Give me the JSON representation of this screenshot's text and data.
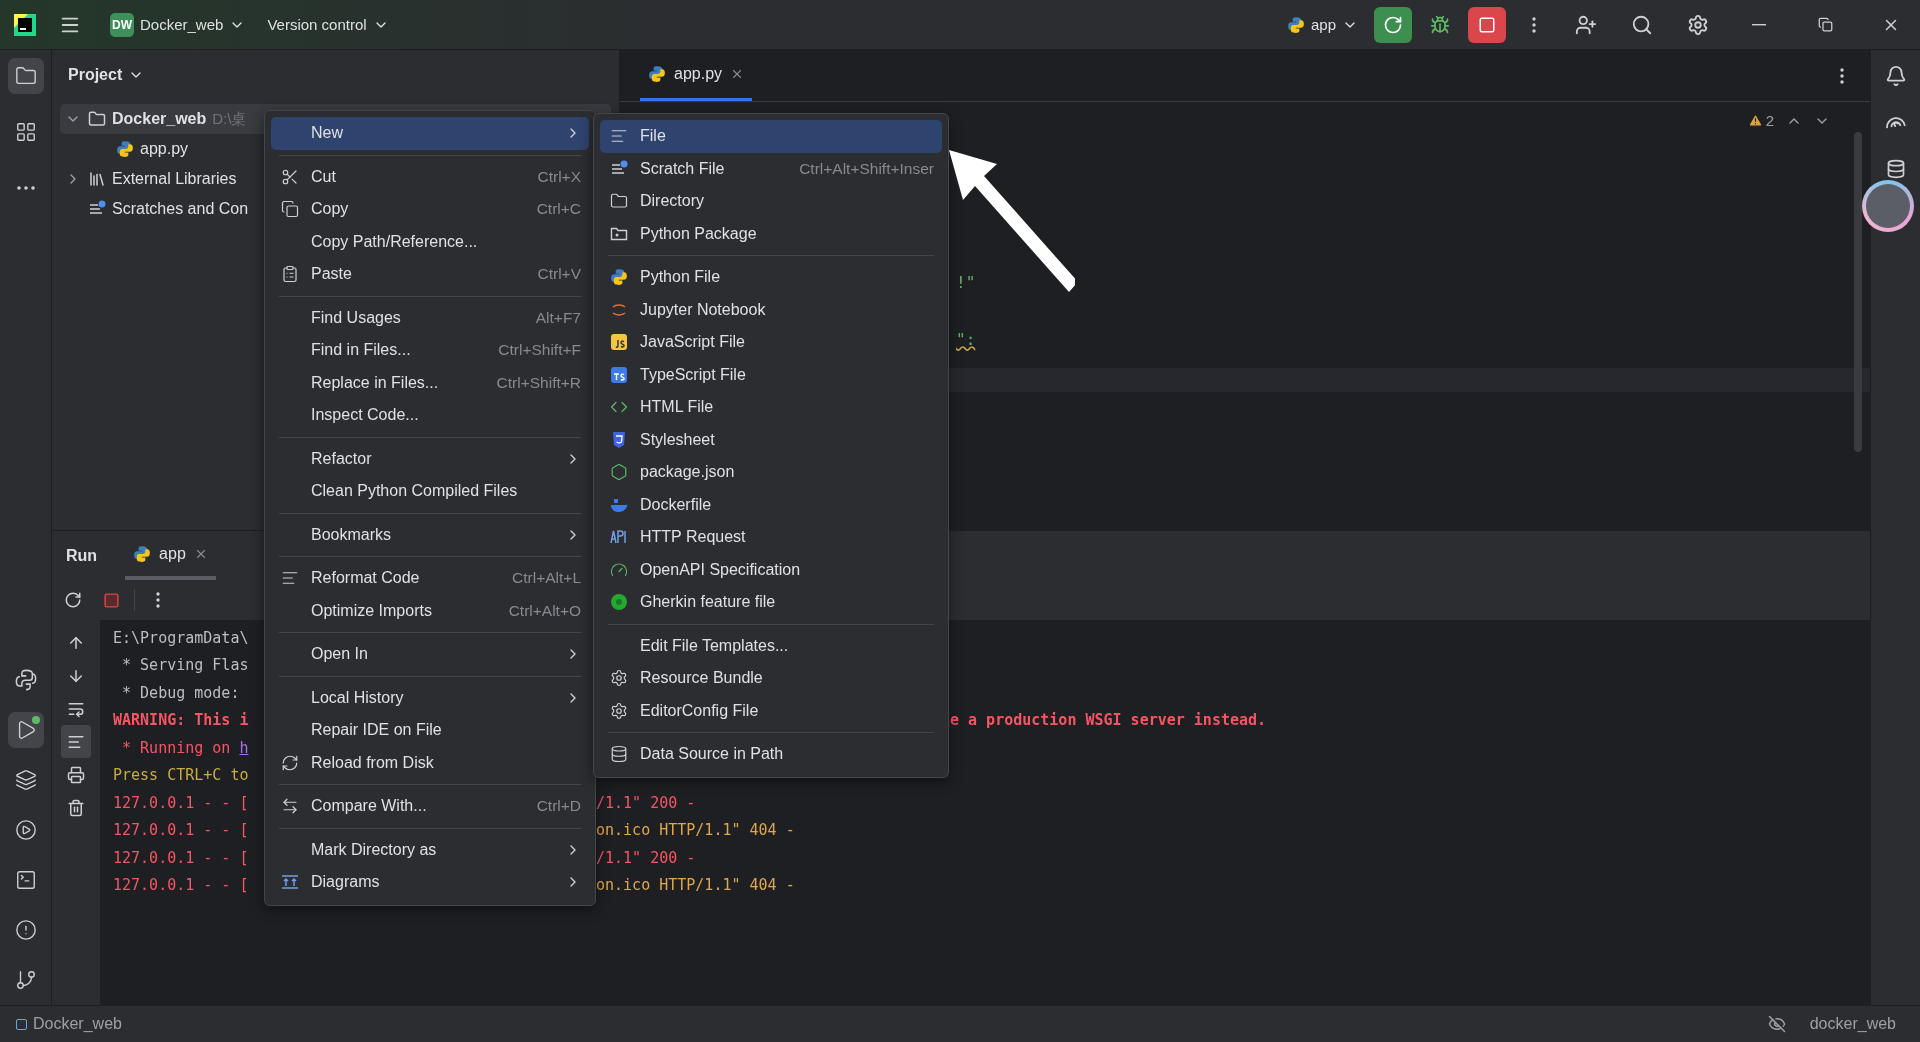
{
  "title_bar": {
    "project_badge": "DW",
    "project": "Docker_web",
    "vcs": "Version control",
    "run_config": "app"
  },
  "left_toolbar": {
    "top": [
      {
        "kind": "folder",
        "selected": true,
        "running": false
      },
      {
        "kind": "structure",
        "selected": false,
        "running": false
      },
      {
        "kind": "more",
        "selected": false,
        "running": false
      }
    ],
    "bottom": [
      {
        "kind": "python",
        "selected": false,
        "running": false
      },
      {
        "kind": "run",
        "selected": true,
        "running": true
      },
      {
        "kind": "layers",
        "selected": false,
        "running": false
      },
      {
        "kind": "services",
        "selected": false,
        "running": false
      },
      {
        "kind": "terminal",
        "selected": false,
        "running": false
      },
      {
        "kind": "problems",
        "selected": false,
        "running": false
      },
      {
        "kind": "git",
        "selected": false,
        "running": false
      }
    ]
  },
  "project_panel": {
    "title": "Project",
    "tree": [
      {
        "label": "Docker_web",
        "hint": "D:\\桌",
        "kind": "folder",
        "expanded": true,
        "selected": true,
        "children": [
          {
            "label": "app.py",
            "kind": "python",
            "selected": false
          }
        ]
      },
      {
        "label": "External Libraries",
        "kind": "library",
        "expanded": false,
        "selected": false
      },
      {
        "label": "Scratches and Con",
        "kind": "scratch",
        "selected": false
      }
    ]
  },
  "editor": {
    "tabs": [
      {
        "label": "app.py",
        "selected": true
      }
    ],
    "warnings": "2",
    "code_fragments": [
      {
        "text": "!\"",
        "kind": "plain",
        "color": "#6aab73"
      },
      {
        "text": "\":",
        "kind": "underlined",
        "color": "#6aab73"
      }
    ]
  },
  "run_panel": {
    "title": "Run",
    "tabs": [
      {
        "label": "app",
        "selected": true
      }
    ],
    "console": [
      {
        "kind": "plain",
        "parts": [
          {
            "text": "E:\\ProgramData\\",
            "kind": "text",
            "color": "#bcbec4"
          }
        ]
      },
      {
        "kind": "plain",
        "parts": [
          {
            "text": " * Serving Flas",
            "kind": "text",
            "color": "#bcbec4"
          }
        ]
      },
      {
        "kind": "plain",
        "parts": [
          {
            "text": " * Debug mode: ",
            "kind": "text",
            "color": "#bcbec4"
          }
        ]
      },
      {
        "kind": "far",
        "parts": [
          {
            "text": "WARNING: This i",
            "kind": "bold",
            "color": "#f75464"
          }
        ],
        "rest": [
          {
            "text": "e a production WSGI server instead.",
            "kind": "bold",
            "color": "#f75464"
          }
        ]
      },
      {
        "kind": "plain",
        "parts": [
          {
            "text": " * Running on ",
            "kind": "text",
            "color": "#f75464"
          },
          {
            "text": "h",
            "kind": "link",
            "color": "#a571e6"
          }
        ]
      },
      {
        "kind": "plain",
        "parts": [
          {
            "text": "Press CTRL+C to",
            "kind": "text",
            "color": "#c9ad3e"
          }
        ]
      },
      {
        "kind": "near",
        "parts": [
          {
            "text": "127.0.0.1 - - [",
            "kind": "text",
            "color": "#f75464"
          }
        ],
        "rest": [
          {
            "text": "/1.1\" 200 -",
            "kind": "text",
            "color": "#f75464"
          }
        ]
      },
      {
        "kind": "near",
        "parts": [
          {
            "text": "127.0.0.1 - - [",
            "kind": "text",
            "color": "#f75464"
          }
        ],
        "rest": [
          {
            "text": "on.ico HTTP/1.1\" 404 -",
            "kind": "text",
            "color": "#e0a84a"
          }
        ]
      },
      {
        "kind": "near",
        "parts": [
          {
            "text": "127.0.0.1 - - [",
            "kind": "text",
            "color": "#f75464"
          }
        ],
        "rest": [
          {
            "text": "/1.1\" 200 -",
            "kind": "text",
            "color": "#f75464"
          }
        ]
      },
      {
        "kind": "near",
        "parts": [
          {
            "text": "127.0.0.1 - - [",
            "kind": "text",
            "color": "#f75464"
          }
        ],
        "rest": [
          {
            "text": "on.ico HTTP/1.1\" 404 -",
            "kind": "text",
            "color": "#e0a84a"
          }
        ]
      }
    ]
  },
  "context_menu": {
    "groups": [
      [
        {
          "label": "New",
          "kind": "plain",
          "submenu": true,
          "selected": true
        }
      ],
      [
        {
          "label": "Cut",
          "shortcut": "Ctrl+X",
          "kind": "cut",
          "submenu": false,
          "selected": false
        },
        {
          "label": "Copy",
          "shortcut": "Ctrl+C",
          "kind": "copy",
          "submenu": false,
          "selected": false
        },
        {
          "label": "Copy Path/Reference...",
          "kind": "plain",
          "submenu": false,
          "selected": false
        },
        {
          "label": "Paste",
          "shortcut": "Ctrl+V",
          "kind": "paste",
          "submenu": false,
          "selected": false
        }
      ],
      [
        {
          "label": "Find Usages",
          "shortcut": "Alt+F7",
          "kind": "plain",
          "submenu": false,
          "selected": false
        },
        {
          "label": "Find in Files...",
          "shortcut": "Ctrl+Shift+F",
          "kind": "plain",
          "submenu": false,
          "selected": false
        },
        {
          "label": "Replace in Files...",
          "shortcut": "Ctrl+Shift+R",
          "kind": "plain",
          "submenu": false,
          "selected": false
        },
        {
          "label": "Inspect Code...",
          "kind": "plain",
          "submenu": false,
          "selected": false
        }
      ],
      [
        {
          "label": "Refactor",
          "kind": "plain",
          "submenu": true,
          "selected": false
        },
        {
          "label": "Clean Python Compiled Files",
          "kind": "plain",
          "submenu": false,
          "selected": false
        }
      ],
      [
        {
          "label": "Bookmarks",
          "kind": "plain",
          "submenu": true,
          "selected": false
        }
      ],
      [
        {
          "label": "Reformat Code",
          "shortcut": "Ctrl+Alt+L",
          "kind": "reformat",
          "submenu": false,
          "selected": false
        },
        {
          "label": "Optimize Imports",
          "shortcut": "Ctrl+Alt+O",
          "kind": "plain",
          "submenu": false,
          "selected": false
        }
      ],
      [
        {
          "label": "Open In",
          "kind": "plain",
          "submenu": true,
          "selected": false
        }
      ],
      [
        {
          "label": "Local History",
          "kind": "plain",
          "submenu": true,
          "selected": false
        },
        {
          "label": "Repair IDE on File",
          "kind": "plain",
          "submenu": false,
          "selected": false
        },
        {
          "label": "Reload from Disk",
          "kind": "reload",
          "submenu": false,
          "selected": false
        }
      ],
      [
        {
          "label": "Compare With...",
          "shortcut": "Ctrl+D",
          "kind": "compare",
          "submenu": false,
          "selected": false
        }
      ],
      [
        {
          "label": "Mark Directory as",
          "kind": "plain",
          "submenu": true,
          "selected": false
        },
        {
          "label": "Diagrams",
          "kind": "diagram",
          "submenu": true,
          "selected": false
        }
      ]
    ]
  },
  "submenu": {
    "groups": [
      [
        {
          "label": "File",
          "kind": "file",
          "submenu": false,
          "selected": true
        },
        {
          "label": "Scratch File",
          "shortcut": "Ctrl+Alt+Shift+Inser",
          "kind": "scratch",
          "submenu": false,
          "selected": false
        },
        {
          "label": "Directory",
          "kind": "folder",
          "submenu": false,
          "selected": false
        },
        {
          "label": "Python Package",
          "kind": "package",
          "submenu": false,
          "selected": false
        }
      ],
      [
        {
          "label": "Python File",
          "kind": "python",
          "submenu": false,
          "selected": false
        },
        {
          "label": "Jupyter Notebook",
          "kind": "jupyter",
          "submenu": false,
          "selected": false
        },
        {
          "label": "JavaScript File",
          "kind": "js",
          "submenu": false,
          "selected": false
        },
        {
          "label": "TypeScript File",
          "kind": "ts",
          "submenu": false,
          "selected": false
        },
        {
          "label": "HTML File",
          "kind": "html",
          "submenu": false,
          "selected": false
        },
        {
          "label": "Stylesheet",
          "kind": "css",
          "submenu": false,
          "selected": false
        },
        {
          "label": "package.json",
          "kind": "node",
          "submenu": false,
          "selected": false
        },
        {
          "label": "Dockerfile",
          "kind": "docker",
          "submenu": false,
          "selected": false
        },
        {
          "label": "HTTP Request",
          "kind": "api",
          "submenu": false,
          "selected": false
        },
        {
          "label": "OpenAPI Specification",
          "kind": "openapi",
          "submenu": false,
          "selected": false
        },
        {
          "label": "Gherkin feature file",
          "kind": "gherkin",
          "submenu": false,
          "selected": false
        }
      ],
      [
        {
          "label": "Edit File Templates...",
          "kind": "plain",
          "submenu": false,
          "selected": false
        },
        {
          "label": "Resource Bundle",
          "kind": "gear",
          "submenu": false,
          "selected": false
        },
        {
          "label": "EditorConfig File",
          "kind": "gear",
          "submenu": false,
          "selected": false
        }
      ],
      [
        {
          "label": "Data Source in Path",
          "kind": "database",
          "submenu": false,
          "selected": false
        }
      ]
    ]
  },
  "status_bar": {
    "project": "Docker_web",
    "interpreter": "docker_web"
  }
}
